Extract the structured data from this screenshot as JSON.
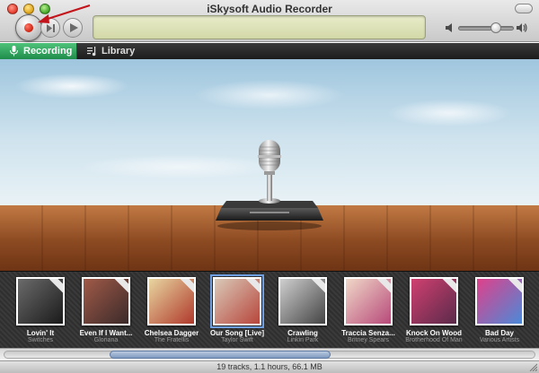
{
  "window": {
    "title": "iSkysoft Audio Recorder"
  },
  "colors": {
    "accent_tab": "#2fa85e",
    "record_red": "#d0200f",
    "lcd": "#dfe3bc"
  },
  "toolbar": {
    "record_icon": "record-icon",
    "skip_icon": "skip-forward-icon",
    "play_icon": "play-icon",
    "volume_level": 0.65
  },
  "tabs": [
    {
      "label": "Recording",
      "icon": "microphone-icon",
      "active": true
    },
    {
      "label": "Library",
      "icon": "music-note-icon",
      "active": false
    }
  ],
  "albums": [
    {
      "title": "Lovin' It",
      "artist": "Switches",
      "color": "#6b6b6b",
      "color2": "#1a1a1a",
      "selected": false
    },
    {
      "title": "Even If I Want...",
      "artist": "Gloriana",
      "color": "#a05a48",
      "color2": "#3b2a2a",
      "selected": false
    },
    {
      "title": "Chelsea Dagger",
      "artist": "The Fratellis",
      "color": "#e8d6a0",
      "color2": "#b0392c",
      "selected": false
    },
    {
      "title": "Our Song [Live]",
      "artist": "Taylor Swift",
      "color": "#d9c9b8",
      "color2": "#b8463c",
      "selected": true
    },
    {
      "title": "Crawling",
      "artist": "Linkin Park",
      "color": "#cfcfcf",
      "color2": "#444444",
      "selected": false
    },
    {
      "title": "Traccia Senza...",
      "artist": "Britney Spears",
      "color": "#f0d8c8",
      "color2": "#b84a7a",
      "selected": false
    },
    {
      "title": "Knock On Wood",
      "artist": "Brotherhood Of Man",
      "color": "#d04070",
      "color2": "#5a2a4a",
      "selected": false
    },
    {
      "title": "Bad Day",
      "artist": "Various Artists",
      "color": "#e0408a",
      "color2": "#4a8ad8",
      "selected": false
    }
  ],
  "status": {
    "text": "19 tracks, 1.1 hours, 66.1 MB"
  }
}
